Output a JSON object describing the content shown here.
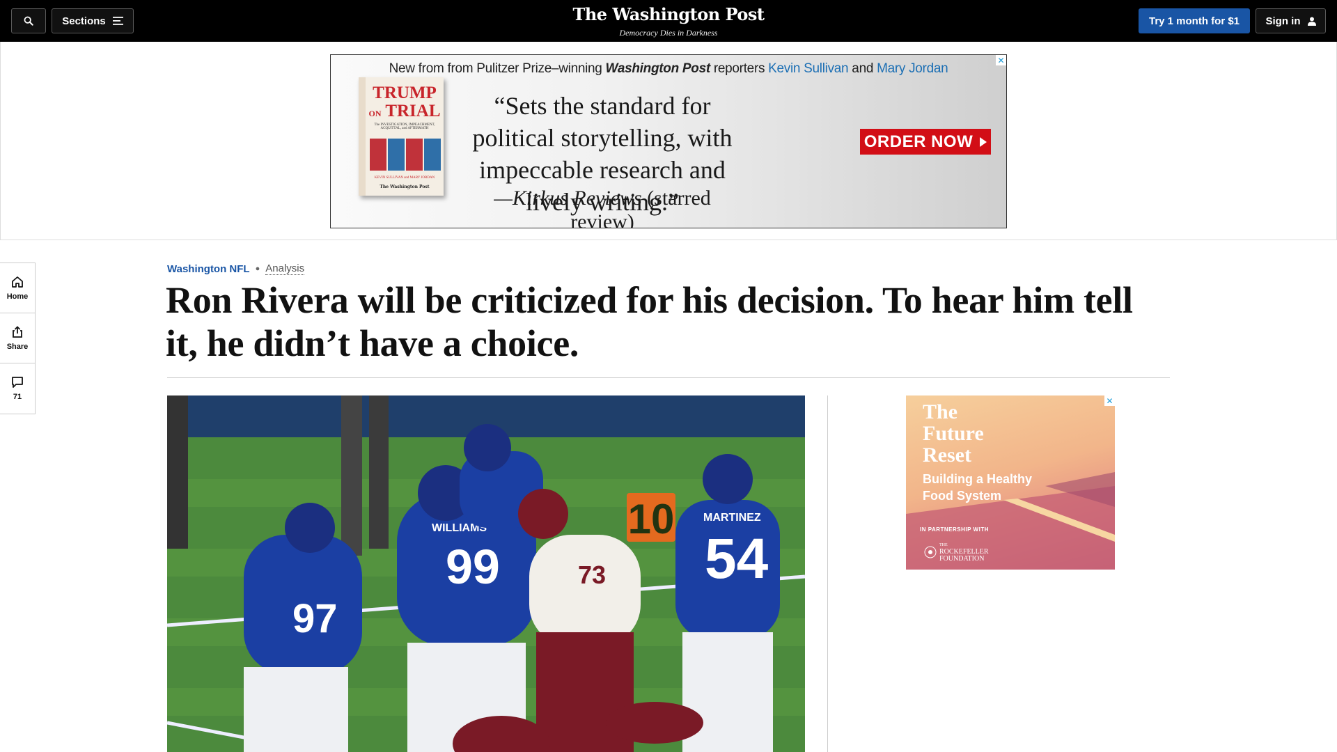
{
  "nav": {
    "sections_label": "Sections",
    "try_label": "Try 1 month for $1",
    "signin_label": "Sign in",
    "logo": "The Washington Post",
    "tagline": "Democracy Dies in Darkness"
  },
  "top_ad": {
    "headline_pre": "New from from Pulitzer Prize–winning",
    "headline_pub": "Washington Post",
    "headline_mid": "reporters",
    "author1": "Kevin Sullivan",
    "and": "and",
    "author2": "Mary Jordan",
    "book_title_1": "TRUMP",
    "book_title_on": "ON",
    "book_title_2": "TRIAL",
    "book_subtitle": "The INVESTIGATION, IMPEACHMENT, ACQUITTAL, and AFTERMATH",
    "book_authors": "KEVIN SULLIVAN and MARY JORDAN",
    "book_publisher": "The Washington Post",
    "quote": "“Sets the standard for political storytelling, with impeccable research and lively writing.”",
    "attrib_source": "—Kirkus Reviews",
    "attrib_note": "(starred review)",
    "cta": "ORDER NOW",
    "close": "✕"
  },
  "rail": {
    "home_label": "Home",
    "share_label": "Share",
    "comments_count": "71"
  },
  "article": {
    "section": "Washington NFL",
    "label": "Analysis",
    "headline": "Ron Rivera will be criticized for his decision. To hear him tell it, he didn’t have a choice."
  },
  "photo": {
    "jersey_97": "97",
    "jersey_99": "99",
    "jersey_54": "54",
    "jersey_73": "73",
    "name_williams": "WILLIAMS",
    "name_martinez": "MARTINEZ",
    "marker": "10"
  },
  "side_ad": {
    "title": "The Future Reset",
    "subtitle": "Building a Healthy Food System",
    "partner": "IN PARTNERSHIP WITH",
    "sponsor_the": "THE",
    "sponsor_name": "ROCKEFELLER FOUNDATION",
    "close": "✕"
  },
  "colors": {
    "accent": "#1955a5",
    "ad_red": "#d20e16",
    "link_blue": "#1c6fb4"
  },
  "icons": [
    "search-icon",
    "menu-icon",
    "user-icon",
    "home-icon",
    "share-icon",
    "comment-icon",
    "close-icon",
    "play-arrow-icon"
  ]
}
